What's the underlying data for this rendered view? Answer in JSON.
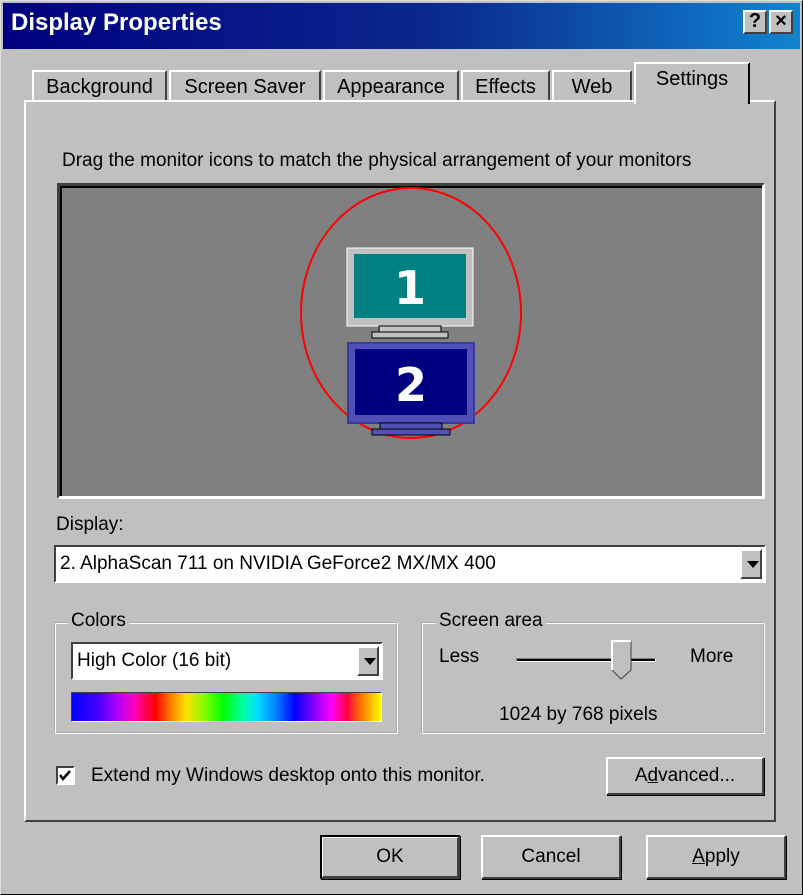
{
  "window": {
    "title": "Display Properties",
    "help_button": "?",
    "close_button": "×"
  },
  "tabs": [
    {
      "label": "Background"
    },
    {
      "label": "Screen Saver"
    },
    {
      "label": "Appearance"
    },
    {
      "label": "Effects"
    },
    {
      "label": "Web"
    },
    {
      "label": "Settings",
      "active": true
    }
  ],
  "settings": {
    "instruction": "Drag the monitor icons to match the physical arrangement of your monitors",
    "monitors": [
      {
        "number": "1",
        "color": "#008080"
      },
      {
        "number": "2",
        "color": "#000080"
      }
    ],
    "display_label": "Display:",
    "display_value": "2. AlphaScan 711 on NVIDIA GeForce2 MX/MX 400",
    "colors_group_label": "Colors",
    "colors_value": "High Color (16 bit)",
    "screen_area_label": "Screen area",
    "less_label": "Less",
    "more_label": "More",
    "screen_area_slider": 0.75,
    "resolution_text": "1024 by 768 pixels",
    "extend_checkbox_label": "Extend my Windows desktop onto this monitor.",
    "extend_checked": true,
    "advanced_button": "Advanced...",
    "advanced_button_mnemonic": "d"
  },
  "footer": {
    "ok": "OK",
    "cancel": "Cancel",
    "apply": "Apply",
    "apply_mnemonic": "A"
  }
}
